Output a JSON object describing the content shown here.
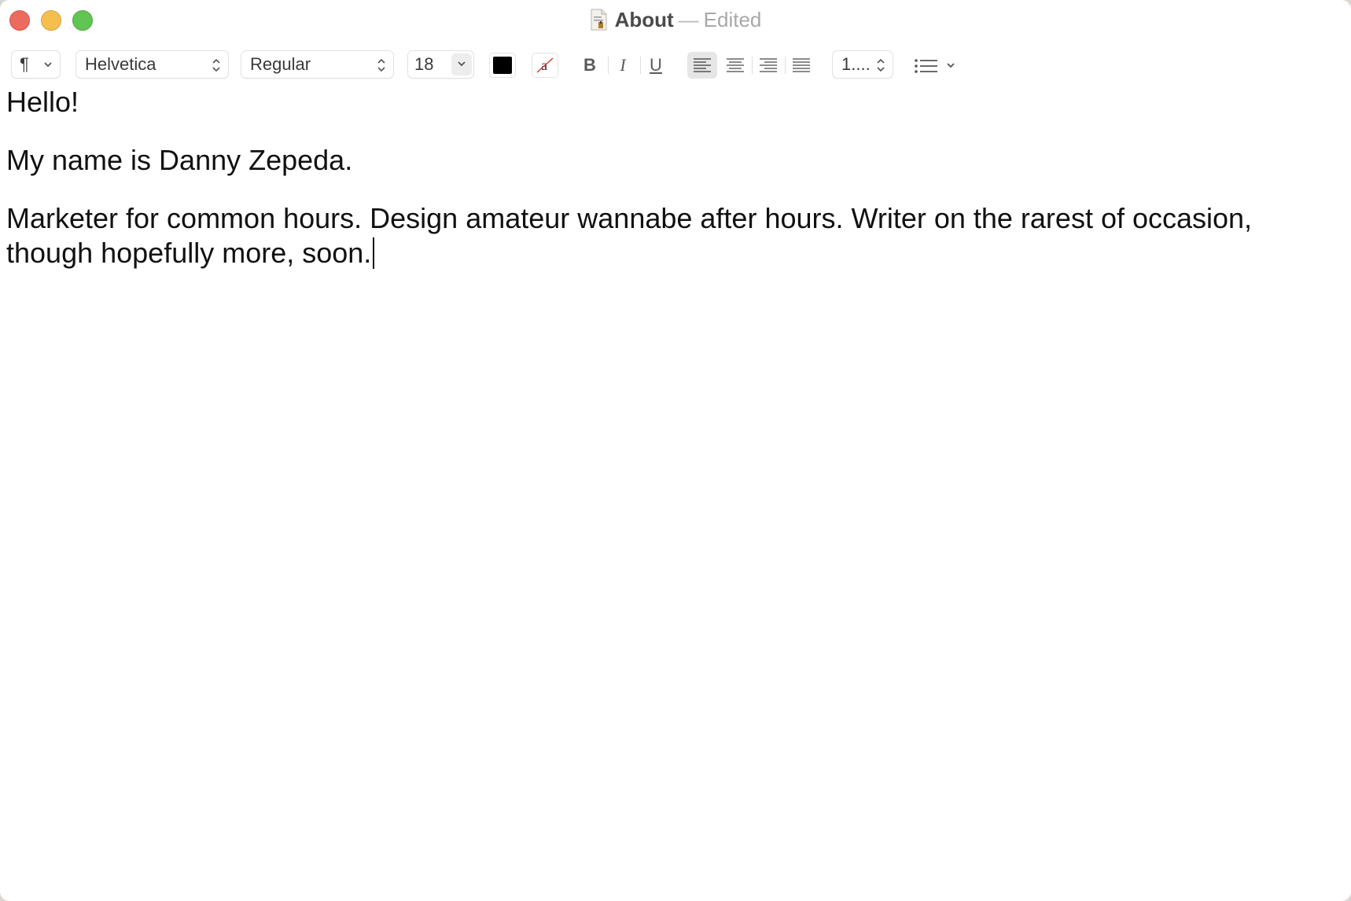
{
  "window": {
    "title": "About",
    "separator": "—",
    "status": "Edited",
    "icon": "document-icon"
  },
  "toolbar": {
    "paragraph_style_label": "¶",
    "font_family": "Helvetica",
    "font_style": "Regular",
    "font_size": "18",
    "text_color": "#000000",
    "bold_label": "B",
    "italic_label": "I",
    "underline_label": "U",
    "alignment_selected": "left",
    "line_spacing": "1....",
    "list_icon": "list-bullets-icon"
  },
  "document": {
    "paragraphs": [
      "Hello!",
      "My name is Danny Zepeda.",
      "Marketer for common hours. Design amateur wannabe after hours. Writer on the rarest of occasion, though hopefully more, soon."
    ]
  }
}
